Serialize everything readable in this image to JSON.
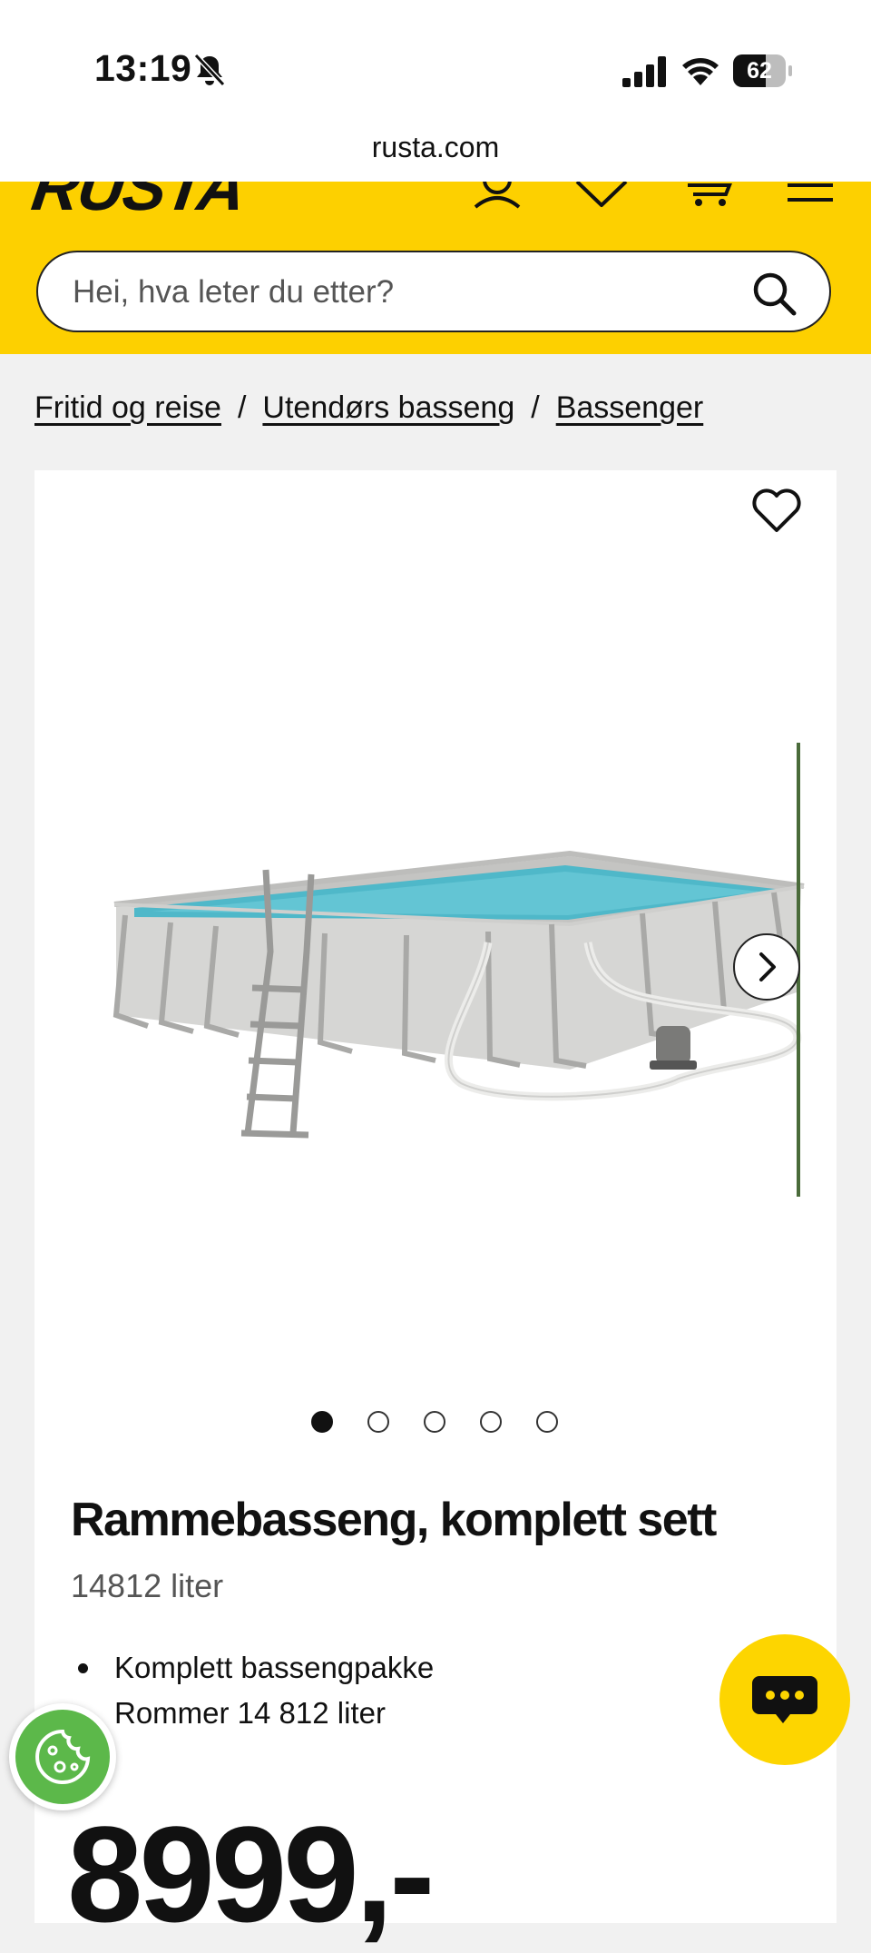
{
  "status_bar": {
    "time": "13:19",
    "battery": "62",
    "battery_level": 0.62,
    "icons": [
      "bell-slash-icon",
      "signal-icon",
      "wifi-icon",
      "battery-icon"
    ]
  },
  "browser": {
    "url": "rusta.com"
  },
  "header": {
    "logo": "RUSTA",
    "icons": [
      "user-icon",
      "heart-icon",
      "cart-icon",
      "menu-icon"
    ],
    "search_placeholder": "Hei, hva leter du etter?",
    "brand_color": "#fdd000"
  },
  "breadcrumb": [
    {
      "label": "Fritid og reise"
    },
    {
      "label": "Utendørs basseng"
    },
    {
      "label": "Bassenger"
    }
  ],
  "breadcrumb_separator": "/",
  "product": {
    "title": "Rammebasseng, komplett sett",
    "subtitle": "14812 liter",
    "bullets": [
      "Komplett bassengpakke",
      "Rommer 14 812 liter"
    ],
    "price": "8999,-",
    "gallery": {
      "count": 5,
      "active_index": 0
    }
  },
  "floating": {
    "chat_icon": "chat-bubble-icon",
    "cookie_icon": "cookie-icon",
    "chat_color": "#fdd500",
    "cookie_color": "#5cb84a"
  }
}
